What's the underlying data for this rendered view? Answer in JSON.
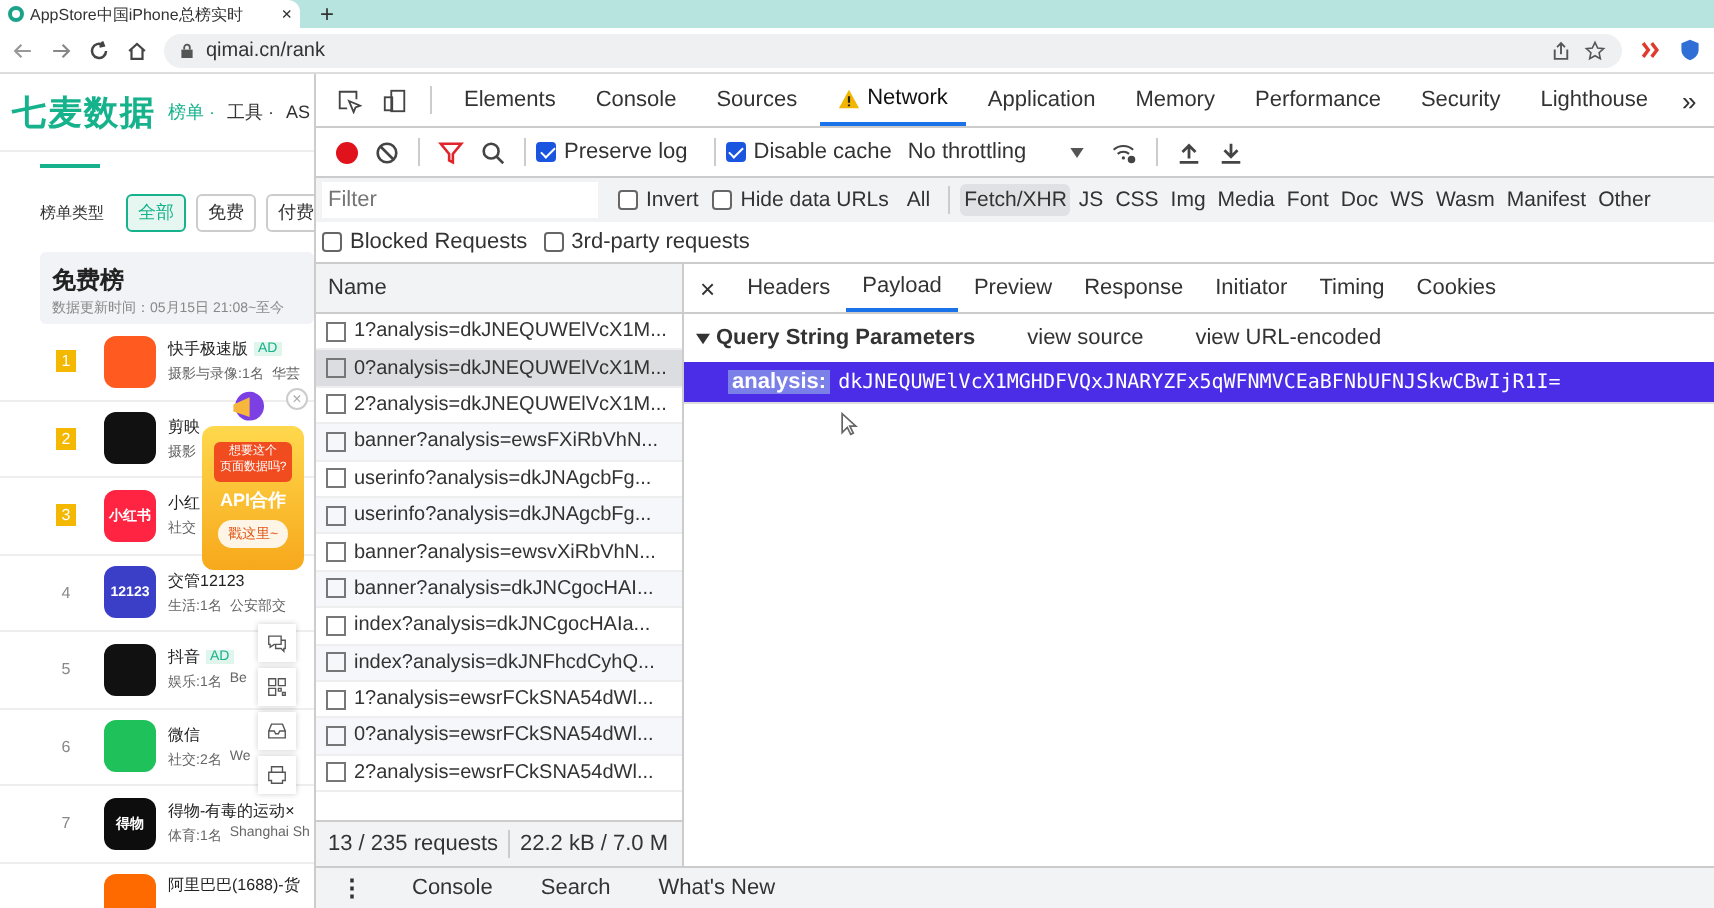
{
  "browser": {
    "tab_title": "AppStore中国iPhone总榜实时",
    "tab_close": "×",
    "new_tab": "+",
    "address": "qimai.cn/rank"
  },
  "page": {
    "logo": "七麦数据",
    "nav": [
      "榜单 ·",
      "工具 ·",
      "AS"
    ],
    "filter_label": "榜单类型",
    "filters": [
      {
        "label": "全部",
        "selected": true
      },
      {
        "label": "免费",
        "selected": false
      },
      {
        "label": "付费",
        "selected": false
      }
    ],
    "list_title": "免费榜",
    "updated": "数据更新时间：05月15日 21:08~至今",
    "apps": [
      {
        "rank": "1",
        "medal": true,
        "name": "快手极速版",
        "tag": "AD",
        "category": "摄影与录像:1名",
        "developer": "华芸",
        "color": "#ff5a1f"
      },
      {
        "rank": "2",
        "medal": true,
        "name": "剪映",
        "category": "摄影",
        "color": "#111111"
      },
      {
        "rank": "3",
        "medal": true,
        "name": "小红",
        "category": "社交",
        "color": "#ff2442",
        "icon_text": "小红书"
      },
      {
        "rank": "4",
        "medal": false,
        "name": "交管12123",
        "category": "生活:1名",
        "developer": "公安部交",
        "color": "#3b3fc8",
        "icon_text": "12123"
      },
      {
        "rank": "5",
        "medal": false,
        "name": "抖音",
        "tag": "AD",
        "category": "娱乐:1名",
        "developer": "Be",
        "color": "#111111"
      },
      {
        "rank": "6",
        "medal": false,
        "name": "微信",
        "category": "社交:2名",
        "developer": "We",
        "color": "#1fc15a"
      },
      {
        "rank": "7",
        "medal": false,
        "name": "得物-有毒的运动×",
        "category": "体育:1名",
        "developer": "Shanghai Sh",
        "color": "#0d0d0d",
        "icon_text": "得物"
      },
      {
        "name": "阿里巴巴(1688)-货",
        "color": "#ff6a00"
      }
    ],
    "promo": {
      "line1": "想要这个",
      "line2": "页面数据吗?",
      "title": "API合作",
      "button": "戳这里~",
      "close": "×"
    }
  },
  "devtools": {
    "tabs": [
      {
        "label": "Elements",
        "selected": false,
        "warning": false
      },
      {
        "label": "Console",
        "selected": false,
        "warning": false
      },
      {
        "label": "Sources",
        "selected": false,
        "warning": false
      },
      {
        "label": "Network",
        "selected": true,
        "warning": true
      },
      {
        "label": "Application",
        "selected": false,
        "warning": false
      },
      {
        "label": "Memory",
        "selected": false,
        "warning": false
      },
      {
        "label": "Performance",
        "selected": false,
        "warning": false
      },
      {
        "label": "Security",
        "selected": false,
        "warning": false
      },
      {
        "label": "Lighthouse",
        "selected": false,
        "warning": false
      }
    ],
    "more_tabs": "»",
    "toolbar": {
      "recording": true,
      "preserve_log": {
        "label": "Preserve log",
        "checked": true
      },
      "disable_cache": {
        "label": "Disable cache",
        "checked": true
      },
      "throttling": "No throttling"
    },
    "filter": {
      "placeholder": "Filter",
      "invert": {
        "label": "Invert",
        "checked": false
      },
      "hide_data_urls": {
        "label": "Hide data URLs",
        "checked": false
      },
      "types": [
        {
          "label": "All",
          "selected": false
        },
        {
          "label": "Fetch/XHR",
          "selected": true
        },
        {
          "label": "JS",
          "selected": false
        },
        {
          "label": "CSS",
          "selected": false
        },
        {
          "label": "Img",
          "selected": false
        },
        {
          "label": "Media",
          "selected": false
        },
        {
          "label": "Font",
          "selected": false
        },
        {
          "label": "Doc",
          "selected": false
        },
        {
          "label": "WS",
          "selected": false
        },
        {
          "label": "Wasm",
          "selected": false
        },
        {
          "label": "Manifest",
          "selected": false
        },
        {
          "label": "Other",
          "selected": false
        }
      ],
      "blocked": {
        "label": "Blocked Requests",
        "checked": false
      },
      "third_party": {
        "label": "3rd-party requests",
        "checked": false
      }
    },
    "requests": {
      "column": "Name",
      "rows": [
        {
          "name": "1?analysis=dkJNEQUWElVcX1M...",
          "selected": false
        },
        {
          "name": "0?analysis=dkJNEQUWElVcX1M...",
          "selected": true
        },
        {
          "name": "2?analysis=dkJNEQUWElVcX1M...",
          "selected": false
        },
        {
          "name": "banner?analysis=ewsFXiRbVhN...",
          "selected": false
        },
        {
          "name": "userinfo?analysis=dkJNAgcbFg...",
          "selected": false
        },
        {
          "name": "userinfo?analysis=dkJNAgcbFg...",
          "selected": false
        },
        {
          "name": "banner?analysis=ewsvXiRbVhN...",
          "selected": false
        },
        {
          "name": "banner?analysis=dkJNCgocHAI...",
          "selected": false
        },
        {
          "name": "index?analysis=dkJNCgocHAIa...",
          "selected": false
        },
        {
          "name": "index?analysis=dkJNFhcdCyhQ...",
          "selected": false
        },
        {
          "name": "1?analysis=ewsrFCkSNA54dWl...",
          "selected": false
        },
        {
          "name": "0?analysis=ewsrFCkSNA54dWl...",
          "selected": false
        },
        {
          "name": "2?analysis=ewsrFCkSNA54dWl...",
          "selected": false
        }
      ],
      "count": "13 / 235 requests",
      "size": "22.2 kB / 7.0 M"
    },
    "details": {
      "close": "×",
      "tabs": [
        {
          "label": "Headers",
          "selected": false
        },
        {
          "label": "Payload",
          "selected": true
        },
        {
          "label": "Preview",
          "selected": false
        },
        {
          "label": "Response",
          "selected": false
        },
        {
          "label": "Initiator",
          "selected": false
        },
        {
          "label": "Timing",
          "selected": false
        },
        {
          "label": "Cookies",
          "selected": false
        }
      ],
      "section": {
        "title": "Query String Parameters",
        "expanded": true,
        "links": [
          "view source",
          "view URL-encoded"
        ],
        "params": [
          {
            "key": "analysis:",
            "value": "dkJNEQUWElVcX1MGHDFVQxJNARYZFx5qWFNMVCEaBFNbUFNJSkwCBwIjR1I=",
            "selected": true
          }
        ]
      }
    },
    "drawer": {
      "menu": "⋮",
      "tabs": [
        "Console",
        "Search",
        "What's New"
      ]
    }
  }
}
